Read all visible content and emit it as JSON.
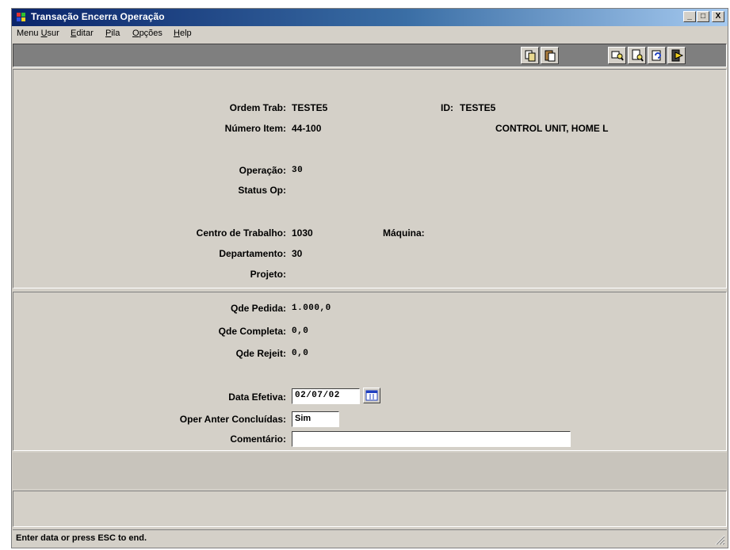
{
  "window": {
    "title": "Transação Encerra Operação",
    "buttons": {
      "minimize": "_",
      "maximize": "□",
      "close": "X"
    }
  },
  "menu": {
    "items": [
      {
        "pre": "Menu ",
        "ul": "U",
        "post": "sur"
      },
      {
        "pre": "",
        "ul": "E",
        "post": "ditar"
      },
      {
        "pre": "",
        "ul": "P",
        "post": "ila"
      },
      {
        "pre": "",
        "ul": "O",
        "post": "pções"
      },
      {
        "pre": "",
        "ul": "H",
        "post": "elp"
      }
    ]
  },
  "toolbar": {
    "icons": [
      "copy-icon",
      "paste-icon",
      "find-next-icon",
      "find-icon",
      "refresh-icon",
      "exit-icon"
    ]
  },
  "header": {
    "ordem_label": "Ordem Trab:",
    "ordem_value": "TESTE5",
    "id_label": "ID:",
    "id_value": "TESTE5",
    "item_label": "Número Item:",
    "item_value": "44-100",
    "item_desc": "CONTROL UNIT, HOME L",
    "operacao_label": "Operação:",
    "operacao_value": "30",
    "status_label": "Status Op:",
    "status_value": "",
    "centro_label": "Centro de Trabalho:",
    "centro_value": "1030",
    "maquina_label": "Máquina:",
    "maquina_value": "",
    "depto_label": "Departamento:",
    "depto_value": "30",
    "projeto_label": "Projeto:",
    "projeto_value": ""
  },
  "quantities": {
    "pedida_label": "Qde Pedida:",
    "pedida_value": "1.000,0",
    "completa_label": "Qde Completa:",
    "completa_value": "0,0",
    "rejeit_label": "Qde Rejeit:",
    "rejeit_value": "0,0"
  },
  "form": {
    "data_label": "Data Efetiva:",
    "data_value": "02/07/02",
    "oper_label": "Oper Anter Concluídas:",
    "oper_value": "Sim",
    "comentario_label": "Comentário:",
    "comentario_value": ""
  },
  "status": {
    "message": "Enter data or press ESC to end."
  }
}
